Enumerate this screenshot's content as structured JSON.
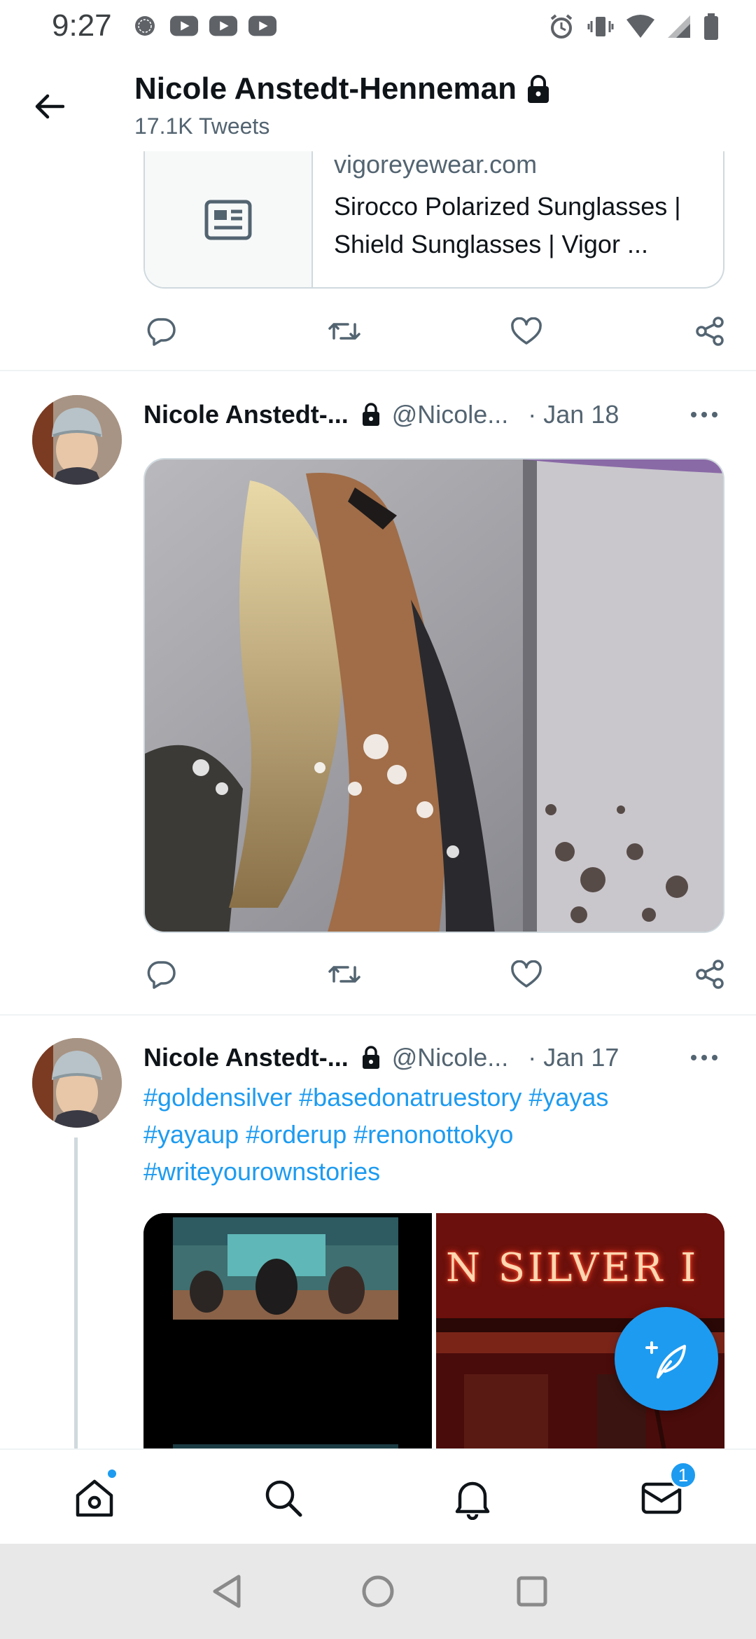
{
  "status_bar": {
    "time": "9:27",
    "left_icons": [
      "signal-app-icon",
      "youtube-icon",
      "youtube-icon",
      "youtube-icon"
    ],
    "right_icons": [
      "alarm-icon",
      "vibrate-icon",
      "wifi-icon",
      "cell-signal-icon",
      "battery-icon"
    ]
  },
  "header": {
    "title": "Nicole Anstedt-Henneman",
    "subtitle": "17.1K Tweets",
    "locked": true
  },
  "link_card": {
    "domain": "vigoreyewear.com",
    "title": "Sirocco Polarized Sunglasses | Shield Sunglasses | Vigor ..."
  },
  "tweets": [
    {
      "name": "Nicole Anstedt-...",
      "handle": "@Nicole...",
      "date": "· Jan 18"
    },
    {
      "name": "Nicole Anstedt-...",
      "handle": "@Nicole...",
      "date": "· Jan 17",
      "hashtags": [
        "#goldensilver",
        "#basedonatruestory",
        "#yayas",
        "#yayaup",
        "#orderup",
        "#renonottokyo",
        "#writeyourownstories"
      ],
      "media_sign_text": "N SILVER I"
    }
  ],
  "bottom_nav": {
    "items": [
      "home-icon",
      "search-icon",
      "bell-icon",
      "mail-icon"
    ],
    "messages_badge": "1"
  },
  "colors": {
    "accent": "#1d9bf0",
    "text_primary": "#0f1419",
    "text_secondary": "#536471",
    "border": "#cfd9de"
  }
}
